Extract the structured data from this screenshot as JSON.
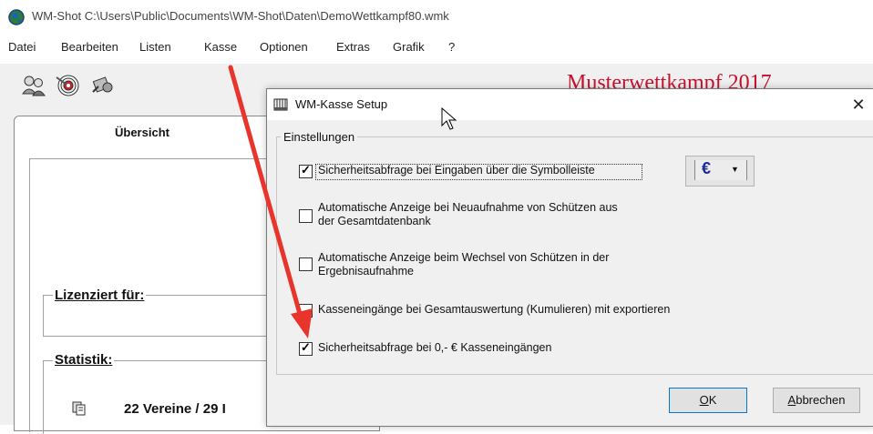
{
  "window": {
    "title": "WM-Shot C:\\Users\\Public\\Documents\\WM-Shot\\Daten\\DemoWettkampf80.wmk"
  },
  "menu": {
    "items": [
      "Datei",
      "Bearbeiten",
      "Listen",
      "Kasse",
      "Optionen",
      "Extras",
      "Grafik",
      "?"
    ]
  },
  "toolbar": {
    "icons": [
      "users-icon",
      "target-icon",
      "tools-icon"
    ]
  },
  "header": {
    "competition_title": "Musterwettkampf 2017"
  },
  "overview": {
    "tab_label": "Übersicht",
    "licensed_label": "Lizenziert für:",
    "statistics_label": "Statistik:",
    "stats_text": "22 Vereine  /  29 I"
  },
  "dialog": {
    "title": "WM-Kasse Setup",
    "group_label": "Einstellungen",
    "options": [
      {
        "label": "Sicherheitsabfrage bei Eingaben über die Symbolleiste",
        "checked": true
      },
      {
        "label_line1": "Automatische Anzeige bei Neuaufnahme von Schützen aus",
        "label_line2": "der Gesamtdatenbank",
        "checked": false
      },
      {
        "label_line1": "Automatische Anzeige beim Wechsel von Schützen in der",
        "label_line2": "Ergebnisaufnahme",
        "checked": false
      },
      {
        "label": "Kasseneingänge bei Gesamtauswertung (Kumulieren) mit exportieren",
        "checked": false
      },
      {
        "label": "Sicherheitsabfrage bei 0,- € Kasseneingängen",
        "checked": true
      }
    ],
    "currency": {
      "symbol": "€",
      "dropdown_arrow": "▼"
    },
    "ok_label": "OK",
    "cancel_label": "Abbrechen",
    "close_glyph": "✕"
  },
  "colors": {
    "accent_red": "#e8342a",
    "title_red": "#c8102e",
    "euro_blue": "#1a2b9a"
  }
}
